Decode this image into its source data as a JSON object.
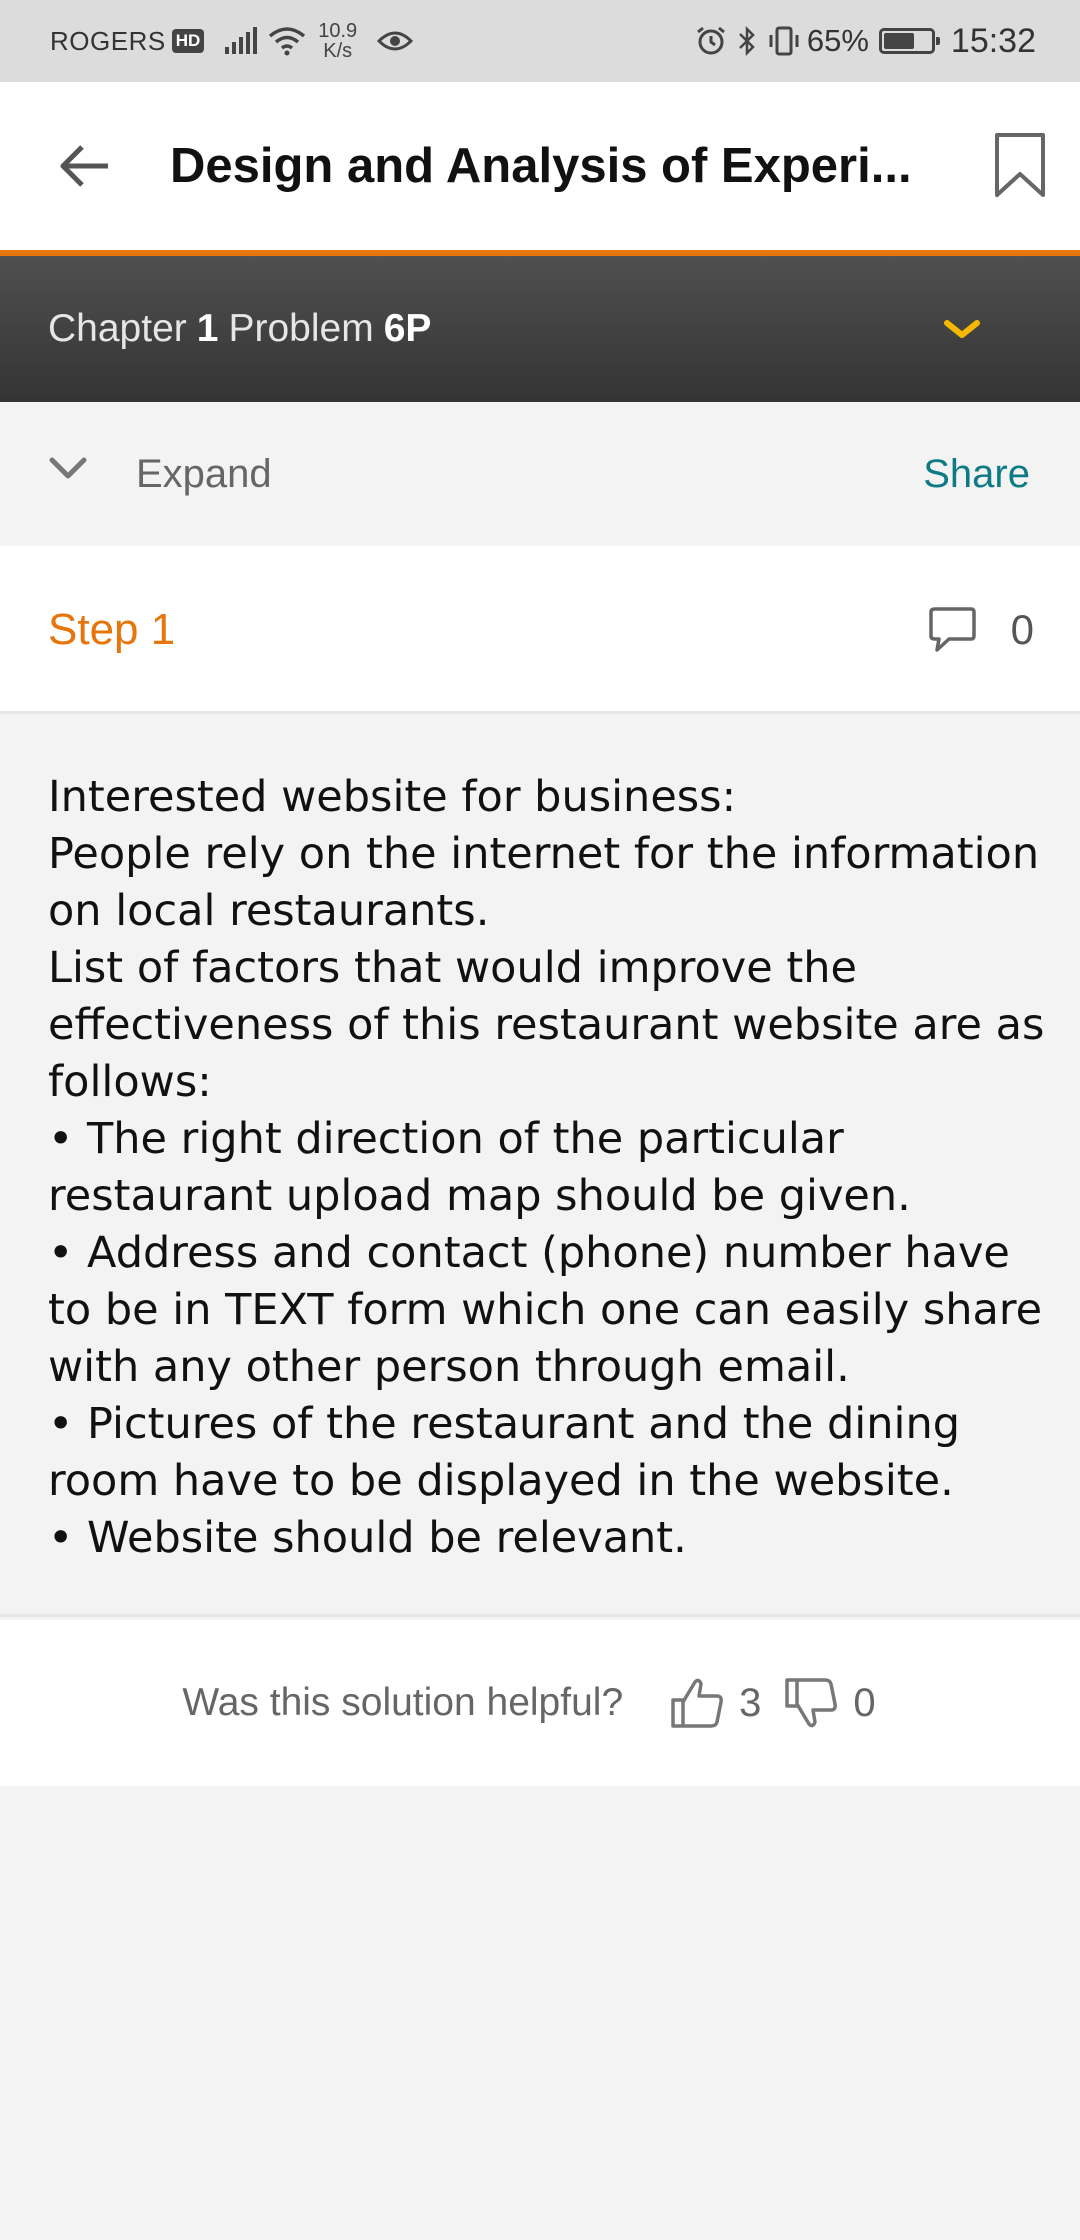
{
  "status_bar": {
    "carrier": "ROGERS",
    "hd_badge": "HD",
    "net_speed_value": "10.9",
    "net_speed_unit": "K/s",
    "battery_percent": "65%",
    "battery_level": 0.65,
    "time": "15:32"
  },
  "app_bar": {
    "title": "Design and Analysis of Experi..."
  },
  "chapter_bar": {
    "chapter_label": "Chapter",
    "chapter_number": "1",
    "problem_label": "Problem",
    "problem_number": "6P"
  },
  "actions": {
    "expand_label": "Expand",
    "share_label": "Share"
  },
  "step": {
    "label": "Step 1",
    "comment_count": "0"
  },
  "solution": {
    "lines": [
      "Interested website for business:",
      "People rely on the internet for the information on local restaurants.",
      "List of factors that would improve the effectiveness of this restaurant website are as follows:",
      "• The right direction of the particular restaurant upload map should be given.",
      "• Address and contact (phone) number have to be in TEXT form which one can easily share with any other person through email.",
      "• Pictures of the restaurant and the dining room have to be displayed in the website.",
      "• Website should be relevant."
    ]
  },
  "feedback": {
    "question": "Was this solution helpful?",
    "upvotes": "3",
    "downvotes": "0"
  },
  "colors": {
    "accent_orange": "#e8740c",
    "share_teal": "#0e7b84",
    "dropdown_yellow": "#f5b800",
    "chapter_bar": "#3d3d3d"
  }
}
